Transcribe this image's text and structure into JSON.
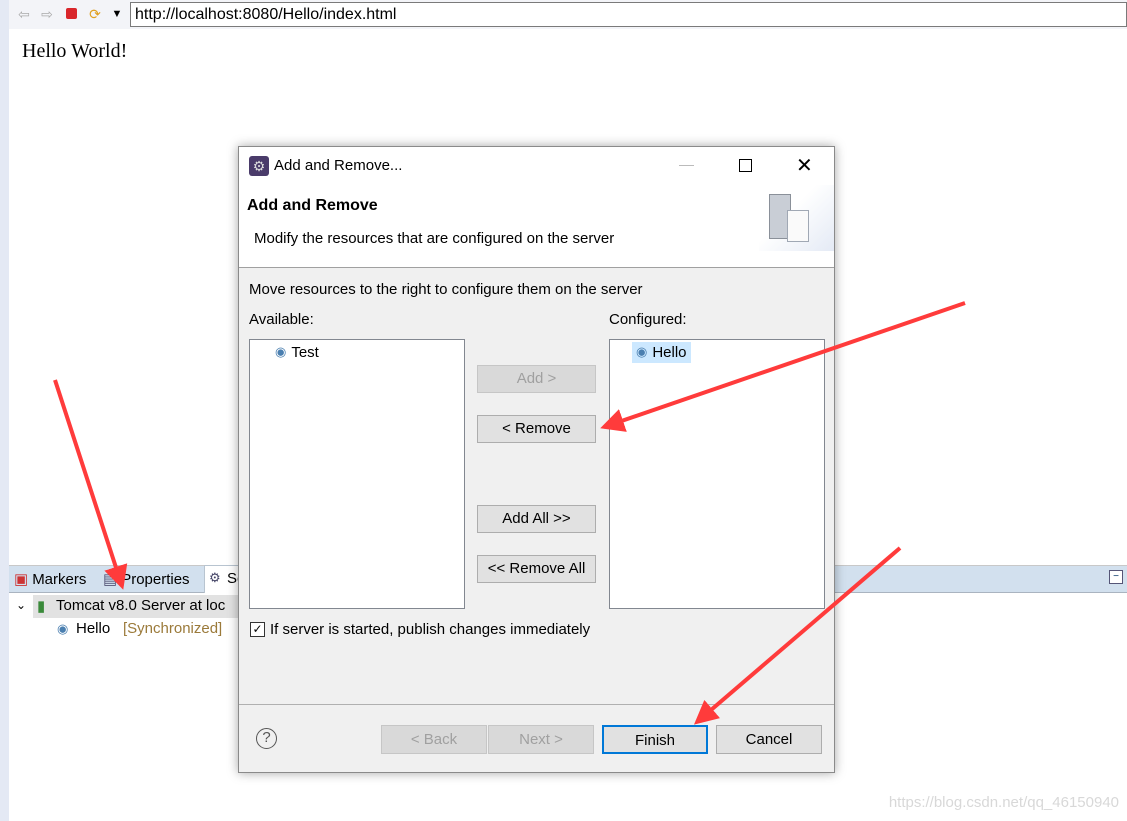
{
  "browser": {
    "url": "http://localhost:8080/Hello/index.html",
    "content": "Hello World!",
    "icons": [
      "back-arrow-icon",
      "forward-arrow-icon",
      "stop-icon",
      "refresh-icon",
      "dropdown-icon"
    ]
  },
  "panel": {
    "tabs": [
      {
        "label": "Markers"
      },
      {
        "label": "Properties"
      },
      {
        "label": "Se"
      }
    ],
    "tree": {
      "server": "Tomcat v8.0 Server at loc",
      "module": "Hello",
      "module_status": "[Synchronized]"
    }
  },
  "dialog": {
    "title": "Add and Remove...",
    "heading": "Add and Remove",
    "description": "Modify the resources that are configured on the server",
    "instruction": "Move resources to the right to configure them on the server",
    "available_label": "Available:",
    "configured_label": "Configured:",
    "available": [
      "Test"
    ],
    "configured": [
      "Hello"
    ],
    "buttons": {
      "add": "Add >",
      "remove": "< Remove",
      "add_all": "Add All >>",
      "remove_all": "<< Remove All"
    },
    "checkbox": {
      "label": "If server is started, publish changes immediately",
      "checked": true
    },
    "footer": {
      "help": "?",
      "back": "< Back",
      "next": "Next >",
      "finish": "Finish",
      "cancel": "Cancel"
    }
  },
  "watermark": "https://blog.csdn.net/qq_46150940",
  "colors": {
    "annotation_arrow": "#ff3b3b",
    "selection": "#cce8ff",
    "finish_border": "#0078d7",
    "status_text": "#9b7a3a"
  }
}
